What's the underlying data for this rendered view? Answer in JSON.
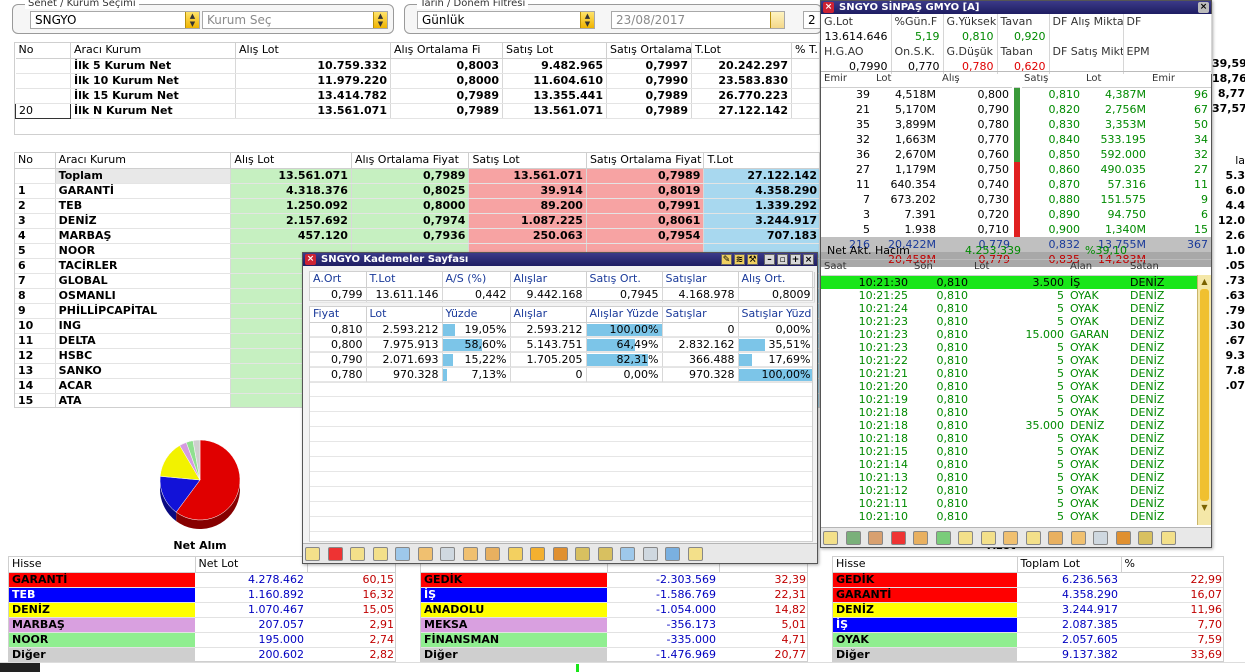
{
  "filters": {
    "senet_title": "Senet / Kurum Seçimi",
    "symbol": "SNGYO",
    "kurum_placeholder": "Kurum Seç",
    "date_title": "Tarih / Dönem Filtresi",
    "period": "Günlük",
    "date": "23/08/2017",
    "extra": "2"
  },
  "summary": {
    "headers": [
      "No",
      "Aracı Kurum",
      "Alış Lot",
      "Alış Ortalama Fi",
      "Satış Lot",
      "Satış Ortalama",
      "T.Lot",
      "% T."
    ],
    "rows": [
      [
        "",
        "İlk 5 Kurum Net",
        "10.759.332",
        "0,8003",
        "9.482.965",
        "0,7997",
        "20.242.297"
      ],
      [
        "",
        "İlk 10 Kurum Net",
        "11.979.220",
        "0,8000",
        "11.604.610",
        "0,7990",
        "23.583.830"
      ],
      [
        "",
        "İlk 15 Kurum Net",
        "13.414.782",
        "0,7989",
        "13.355.441",
        "0,7989",
        "26.770.223"
      ],
      [
        "20",
        "İlk N Kurum Net",
        "13.561.071",
        "0,7989",
        "13.561.071",
        "0,7989",
        "27.122.142"
      ]
    ]
  },
  "brokers": {
    "headers": [
      "No",
      "Aracı Kurum",
      "Alış Lot",
      "Alış Ortalama Fiyat",
      "Satış Lot",
      "Satış Ortalama Fiyat",
      "T.Lot"
    ],
    "total": [
      "",
      "Toplam",
      "13.561.071",
      "0,7989",
      "13.561.071",
      "0,7989",
      "27.122.142"
    ],
    "rows": [
      [
        "1",
        "GARANTİ",
        "4.318.376",
        "0,8025",
        "39.914",
        "0,8019",
        "4.358.290"
      ],
      [
        "2",
        "TEB",
        "1.250.092",
        "0,8000",
        "89.200",
        "0,7991",
        "1.339.292"
      ],
      [
        "3",
        "DENİZ",
        "2.157.692",
        "0,7974",
        "1.087.225",
        "0,8061",
        "3.244.917"
      ],
      [
        "4",
        "MARBAŞ",
        "457.120",
        "0,7936",
        "250.063",
        "0,7954",
        "707.183"
      ],
      [
        "5",
        "NOOR",
        "",
        "",
        "",
        "",
        ""
      ],
      [
        "6",
        "TACİRLER",
        "",
        "",
        "",
        "",
        ""
      ],
      [
        "7",
        "GLOBAL",
        "",
        "",
        "",
        "",
        ""
      ],
      [
        "8",
        "OSMANLI",
        "",
        "",
        "",
        "",
        ""
      ],
      [
        "9",
        "PHİLLİPCAPİTAL",
        "",
        "",
        "",
        "",
        ""
      ],
      [
        "10",
        "ING",
        "",
        "",
        "",
        "",
        ""
      ],
      [
        "11",
        "DELTA",
        "",
        "",
        "",
        "",
        ""
      ],
      [
        "12",
        "HSBC",
        "",
        "",
        "",
        "",
        ""
      ],
      [
        "13",
        "SANKO",
        "",
        "",
        "",
        "",
        ""
      ],
      [
        "14",
        "ACAR",
        "",
        "",
        "",
        "",
        ""
      ],
      [
        "15",
        "ATA",
        "",
        "",
        "",
        "",
        ""
      ]
    ],
    "right_partial": {
      "header": "la",
      "values": [
        "5.3",
        "6.0",
        "4.4",
        "12.0",
        "2.6",
        "1.0",
        ".05",
        ".73",
        ".63",
        ".79",
        ".30",
        ".67",
        "9.3",
        "7.8",
        ".07"
      ]
    }
  },
  "pie": {
    "label": "Net Alım",
    "slices": [
      {
        "name": "GARANTİ",
        "value": 60.15,
        "color": "#e00000"
      },
      {
        "name": "TEB",
        "value": 16.32,
        "color": "#1212d8"
      },
      {
        "name": "DENİZ",
        "value": 15.05,
        "color": "#f2f200"
      },
      {
        "name": "MARBAŞ",
        "value": 2.91,
        "color": "#d59be0"
      },
      {
        "name": "NOOR",
        "value": 2.74,
        "color": "#8fe08f"
      },
      {
        "name": "Diğer",
        "value": 2.82,
        "color": "#cfcfcf"
      }
    ]
  },
  "net_alim": {
    "headers": [
      "Hisse",
      "Net Lot",
      ""
    ],
    "rows": [
      [
        "GARANTİ",
        "4.278.462",
        "60,15"
      ],
      [
        "TEB",
        "1.160.892",
        "16,32"
      ],
      [
        "DENİZ",
        "1.070.467",
        "15,05"
      ],
      [
        "MARBAŞ",
        "207.057",
        "2,91"
      ],
      [
        "NOOR",
        "195.000",
        "2,74"
      ],
      [
        "Diğer",
        "200.602",
        "2,82"
      ]
    ]
  },
  "net_satim": {
    "rows": [
      [
        "GEDİK",
        "-2.303.569",
        "32,39"
      ],
      [
        "İŞ",
        "-1.586.769",
        "22,31"
      ],
      [
        "ANADOLU",
        "-1.054.000",
        "14,82"
      ],
      [
        "MEKSA",
        "-356.173",
        "5,01"
      ],
      [
        "FİNANSMAN",
        "-335.000",
        "4,71"
      ],
      [
        "Diğer",
        "-1.476.969",
        "20,77"
      ]
    ]
  },
  "top_lot": {
    "headers": [
      "Hisse",
      "Toplam Lot",
      "%"
    ],
    "label_partial": "Tlzot",
    "rows": [
      [
        "GEDİK",
        "6.236.563",
        "22,99"
      ],
      [
        "GARANTİ",
        "4.358.290",
        "16,07"
      ],
      [
        "DENİZ",
        "3.244.917",
        "11,96"
      ],
      [
        "İŞ",
        "2.087.385",
        "7,70"
      ],
      [
        "OYAK",
        "2.057.605",
        "7,59"
      ],
      [
        "Diğer",
        "9.137.382",
        "33,69"
      ]
    ]
  },
  "right_edge": {
    "values": [
      "39,59",
      "18,76",
      "8,77",
      "37,57"
    ],
    "headers": [
      "%",
      "Tu"
    ]
  },
  "kademe": {
    "title": "SNGYO Kademeler Sayfası",
    "top_headers": [
      "A.Ort",
      "T.Lot",
      "A/S (%)",
      "Alışlar",
      "Satış Ort.",
      "Satışlar",
      "Alış Ort."
    ],
    "top_values": [
      "0,799",
      "13.611.146",
      "0,442",
      "9.442.168",
      "0,7945",
      "4.168.978",
      "0,8009"
    ],
    "headers": [
      "Fiyat",
      "Lot",
      "Yüzde",
      "Alışlar",
      "Alışlar Yüzde",
      "Satışlar",
      "Satışlar Yüzde"
    ],
    "rows": [
      {
        "fiyat": "0,810",
        "lot": "2.593.212",
        "yuzde": "19,05%",
        "yp": 19.05,
        "alis": "2.593.212",
        "alis_y": "100,00%",
        "ap": 100,
        "satis": "0",
        "satis_y": "0,00%",
        "sp": 0
      },
      {
        "fiyat": "0,800",
        "lot": "7.975.913",
        "yuzde": "58,60%",
        "yp": 58.6,
        "alis": "5.143.751",
        "alis_y": "64,49%",
        "ap": 64.49,
        "satis": "2.832.162",
        "satis_y": "35,51%",
        "sp": 35.51
      },
      {
        "fiyat": "0,790",
        "lot": "2.071.693",
        "yuzde": "15,22%",
        "yp": 15.22,
        "alis": "1.705.205",
        "alis_y": "82,31%",
        "ap": 82.31,
        "satis": "366.488",
        "satis_y": "17,69%",
        "sp": 17.69
      },
      {
        "fiyat": "0,780",
        "lot": "970.328",
        "yuzde": "7,13%",
        "yp": 7.13,
        "alis": "0",
        "alis_y": "0,00%",
        "ap": 0,
        "satis": "970.328",
        "satis_y": "100,00%",
        "sp": 100
      }
    ]
  },
  "quote": {
    "title": "SNGYO SİNPAŞ GMYO [A]",
    "row1_headers": [
      "G.Lot",
      "%Gün.F",
      "G.Yüksek",
      "Tavan",
      "DF Alış Miktar",
      "DF"
    ],
    "row1_values": [
      "13.614.646",
      "5,19",
      "0,810",
      "0,920",
      "",
      ""
    ],
    "row2_headers": [
      "H.G.AO",
      "On.S.K.",
      "G.Düşük",
      "Taban",
      "DF Satış Mikta",
      "EPM"
    ],
    "row2_values": [
      "0,7990",
      "0,770",
      "0,780",
      "0,620",
      "",
      ""
    ],
    "book_headers": [
      "Emir",
      "Lot",
      "Alış",
      "Satış",
      "Lot",
      "Emir"
    ],
    "book": [
      [
        "39",
        "4,518M",
        "0,800",
        "0,810",
        "4,387M",
        "96"
      ],
      [
        "21",
        "5,170M",
        "0,790",
        "0,820",
        "2,756M",
        "67"
      ],
      [
        "35",
        "3,899M",
        "0,780",
        "0,830",
        "3,353M",
        "50"
      ],
      [
        "32",
        "1,663M",
        "0,770",
        "0,840",
        "533.195",
        "34"
      ],
      [
        "36",
        "2,670M",
        "0,760",
        "0,850",
        "592.000",
        "32"
      ],
      [
        "27",
        "1,179M",
        "0,750",
        "0,860",
        "490.035",
        "27"
      ],
      [
        "11",
        "640.354",
        "0,740",
        "0,870",
        "57.316",
        "11"
      ],
      [
        "7",
        "673.202",
        "0,730",
        "0,880",
        "151.575",
        "9"
      ],
      [
        "3",
        "7.391",
        "0,720",
        "0,890",
        "94.750",
        "6"
      ],
      [
        "5",
        "1.938",
        "0,710",
        "0,900",
        "1,340M",
        "15"
      ]
    ],
    "book_total": [
      "216",
      "20,422M",
      "0,779",
      "0,832",
      "13,755M",
      "367"
    ],
    "book_total2": [
      "",
      "20,458M",
      "0,779",
      "0,835",
      "14,283M",
      ""
    ],
    "net_label": "Net Akt. Hacim",
    "net_value": "4.253.339",
    "net_pct": "%39,10",
    "trade_headers": [
      "Saat",
      "Son",
      "Lot",
      "Alan",
      "Satan"
    ],
    "trades": [
      [
        "10:21:30",
        "0,810",
        "3.500",
        "İŞ",
        "DENİZ"
      ],
      [
        "10:21:25",
        "0,810",
        "5",
        "OYAK",
        "DENİZ"
      ],
      [
        "10:21:24",
        "0,810",
        "5",
        "OYAK",
        "DENİZ"
      ],
      [
        "10:21:23",
        "0,810",
        "5",
        "OYAK",
        "DENİZ"
      ],
      [
        "10:21:23",
        "0,810",
        "15.000",
        "GARAN",
        "DENİZ"
      ],
      [
        "10:21:23",
        "0,810",
        "5",
        "OYAK",
        "DENİZ"
      ],
      [
        "10:21:22",
        "0,810",
        "5",
        "OYAK",
        "DENİZ"
      ],
      [
        "10:21:21",
        "0,810",
        "5",
        "OYAK",
        "DENİZ"
      ],
      [
        "10:21:20",
        "0,810",
        "5",
        "OYAK",
        "DENİZ"
      ],
      [
        "10:21:19",
        "0,810",
        "5",
        "OYAK",
        "DENİZ"
      ],
      [
        "10:21:18",
        "0,810",
        "5",
        "OYAK",
        "DENİZ"
      ],
      [
        "10:21:18",
        "0,810",
        "35.000",
        "DENİZ",
        "DENİZ"
      ],
      [
        "10:21:18",
        "0,810",
        "5",
        "OYAK",
        "DENİZ"
      ],
      [
        "10:21:15",
        "0,810",
        "5",
        "OYAK",
        "DENİZ"
      ],
      [
        "10:21:14",
        "0,810",
        "5",
        "OYAK",
        "DENİZ"
      ],
      [
        "10:21:13",
        "0,810",
        "5",
        "OYAK",
        "DENİZ"
      ],
      [
        "10:21:12",
        "0,810",
        "5",
        "OYAK",
        "DENİZ"
      ],
      [
        "10:21:11",
        "0,810",
        "5",
        "OYAK",
        "DENİZ"
      ],
      [
        "10:21:10",
        "0,810",
        "5",
        "OYAK",
        "DENİZ"
      ]
    ]
  },
  "colors": {
    "title_bar": "#1e1d62",
    "buy_green": "#c6f0c1",
    "sell_red": "#f7a3a3",
    "total_blue": "#a8d8ef",
    "highlight_green": "#19e619"
  }
}
